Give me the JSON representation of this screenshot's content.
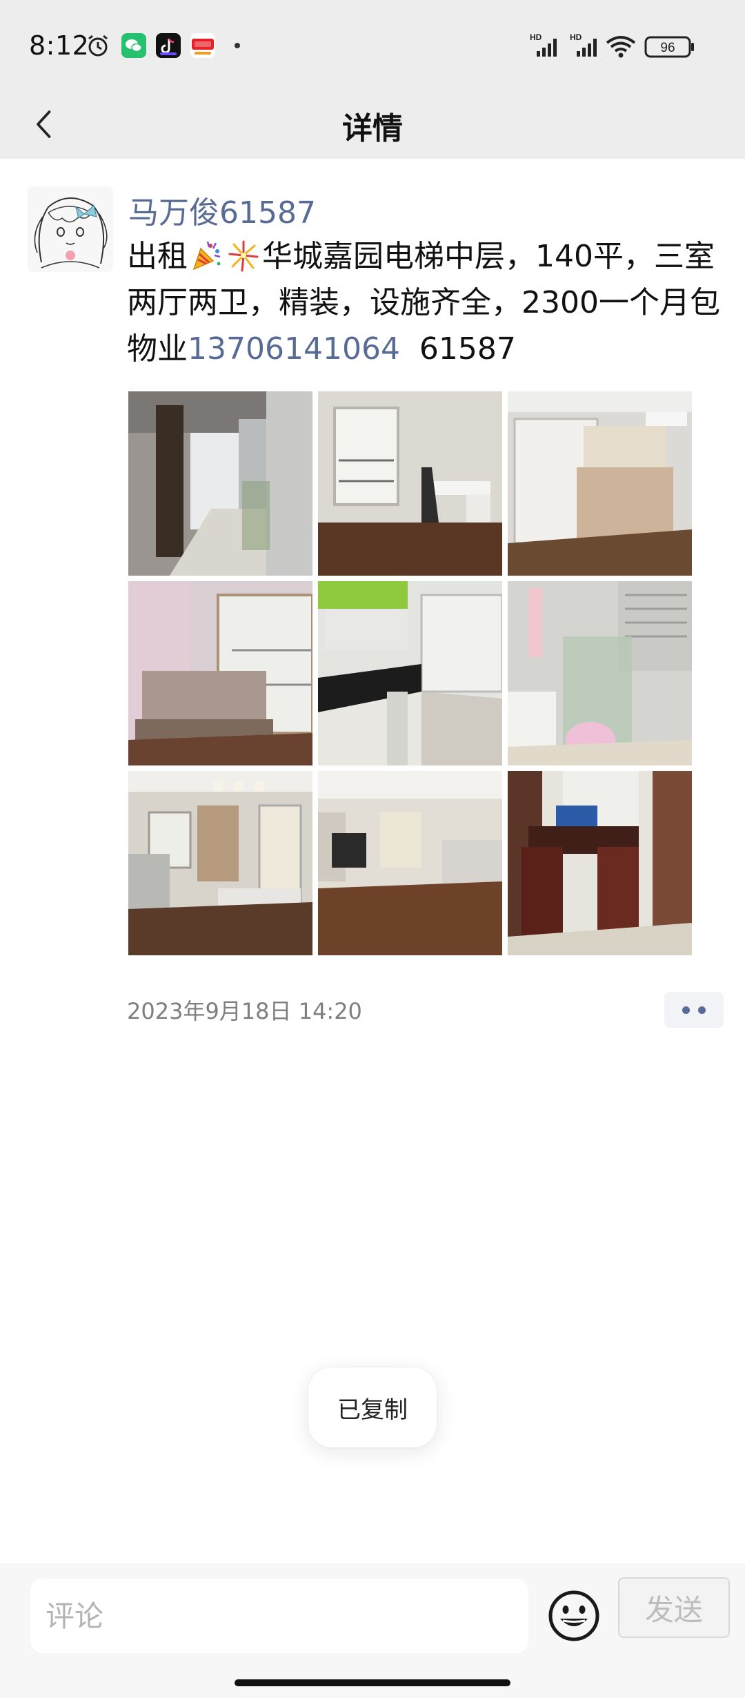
{
  "status_bar": {
    "time": "8:12",
    "battery": "96",
    "network_labels": [
      "HD",
      "HD"
    ],
    "icons": [
      "alarm-icon",
      "wechat-app-icon",
      "tiktok-app-icon",
      "search-app-icon",
      "signal-icon",
      "wifi-icon",
      "battery-icon"
    ]
  },
  "nav": {
    "back_icon": "chevron-left-icon",
    "title": "详情"
  },
  "post": {
    "author": "马万俊61587",
    "text_parts": {
      "prefix": "出租",
      "emojis": [
        "party-popper-emoji",
        "fireworks-emoji"
      ],
      "body": "华城嘉园电梯中层，140平，三室两厅两卫，精装，设施齐全，2300一个月包物业",
      "phone": "13706141064",
      "suffix": "  61587"
    },
    "photos": [
      "kitchen-corridor-photo",
      "study-desk-photo",
      "bedroom-photo-1",
      "bedroom-photo-2",
      "kitchen-photo",
      "bathroom-photo",
      "living-dining-photo",
      "living-room-photo",
      "dining-table-photo"
    ],
    "timestamp": "2023年9月18日 14:20",
    "more_icon": "more-dots-icon"
  },
  "toast": {
    "text": "已复制"
  },
  "comment_bar": {
    "placeholder": "评论",
    "emoji_icon": "smiley-icon",
    "send_label": "发送"
  },
  "colors": {
    "link": "#576b95",
    "top_bg": "#ededed",
    "text": "#111111",
    "muted": "#7f7f7f"
  }
}
